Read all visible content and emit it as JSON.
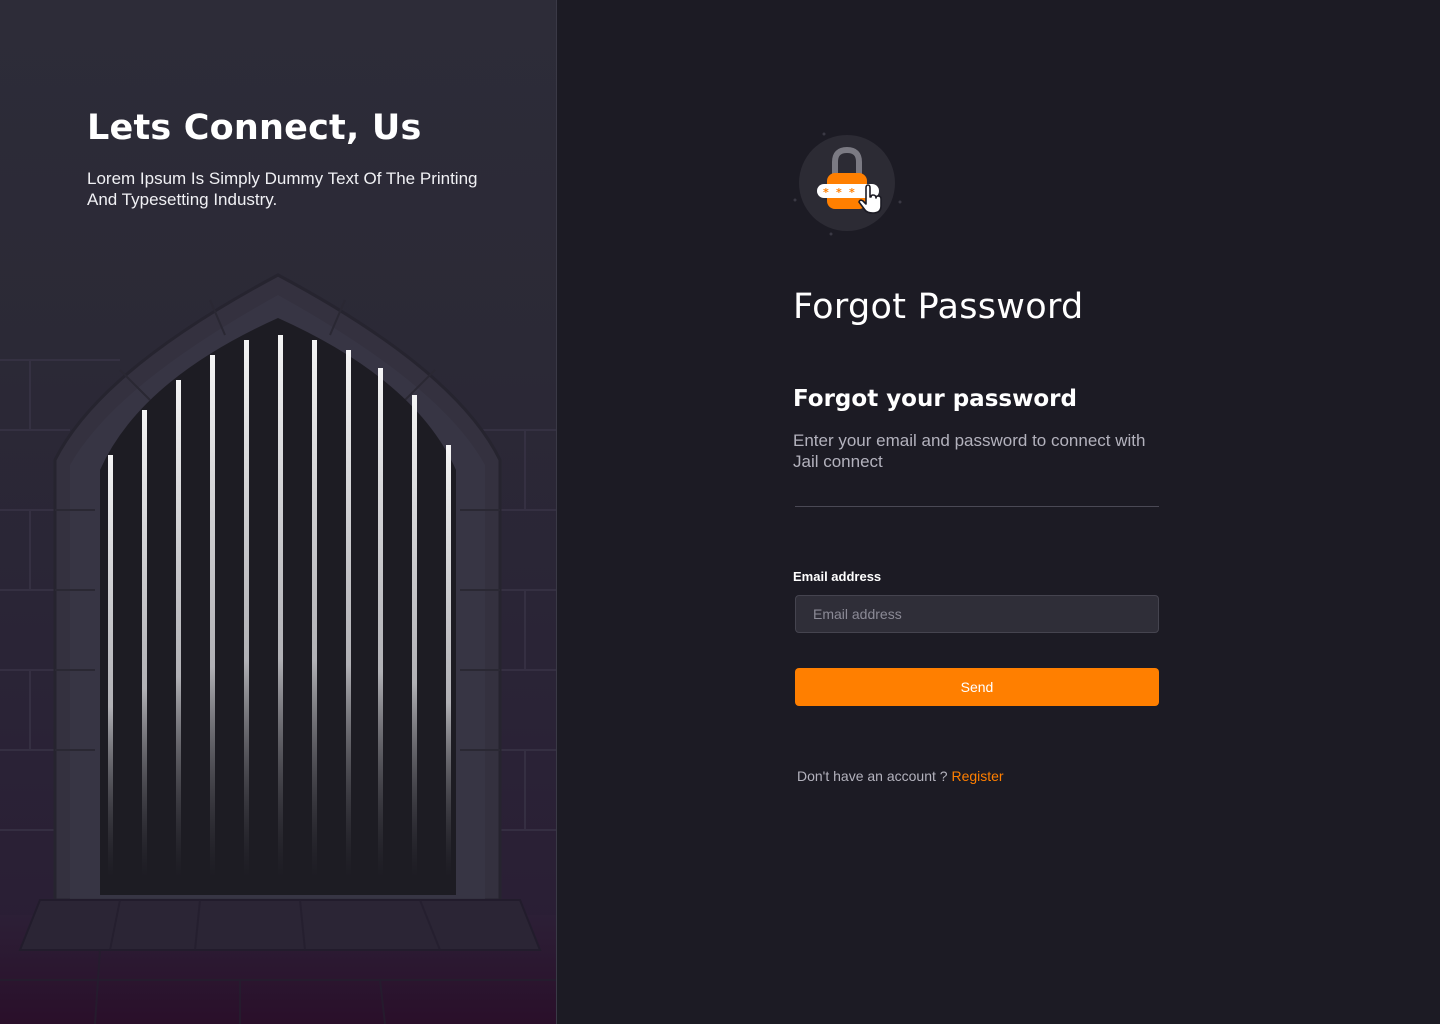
{
  "left_panel": {
    "title": "Lets Connect, Us",
    "subtitle": "Lorem Ipsum Is Simply Dummy Text Of The Printing And Typesetting Industry."
  },
  "form": {
    "page_title": "Forgot Password",
    "section_title": "Forgot your password",
    "section_description": "Enter your email and password to connect with Jail connect",
    "email_label": "Email address",
    "email_placeholder": "Email address",
    "email_value": "",
    "send_label": "Send",
    "footer_prompt": "Don't have an account ?",
    "register_label": "Register"
  },
  "colors": {
    "accent": "#ff7f00",
    "panel_bg": "#1c1b24",
    "left_bg": "#2d2c38"
  },
  "icons": {
    "illustration": "lock-password-icon",
    "cursor": "hand-pointer-icon"
  }
}
